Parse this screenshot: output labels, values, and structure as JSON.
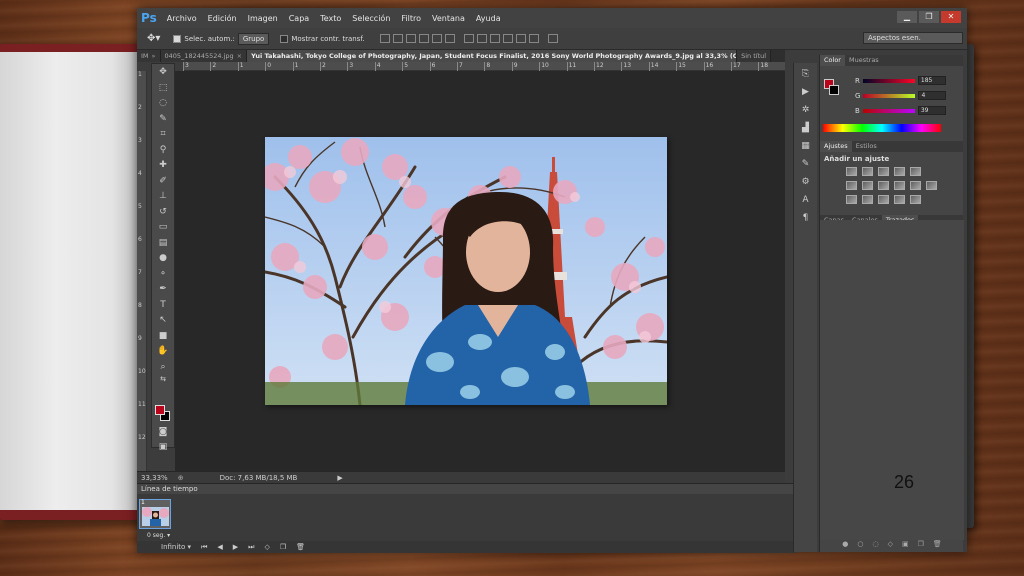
{
  "app": {
    "logo": "Ps",
    "menu": [
      "Archivo",
      "Edición",
      "Imagen",
      "Capa",
      "Texto",
      "Selección",
      "Filtro",
      "Ventana",
      "Ayuda"
    ],
    "window_buttons": [
      "▁",
      "❐",
      "✕"
    ]
  },
  "options_bar": {
    "auto_select_label": "Selec. autom.:",
    "auto_select_value": "Grupo",
    "show_transform_label": "Mostrar contr. transf.",
    "workspace": "Aspectos esen."
  },
  "tabs": [
    {
      "label": "IM",
      "active": false,
      "close": "»"
    },
    {
      "label": "0405_182445524.jpg",
      "active": false,
      "close": "×"
    },
    {
      "label": "Yui Takahashi, Tokyo College of Photography, Japan, Student Focus Finalist, 2016 Sony World Photography Awards_9.jpg al 33,3% (Capa 1, RGB/8*) *",
      "active": true,
      "close": "×"
    },
    {
      "label": "Sin títul",
      "active": false,
      "close": ""
    }
  ],
  "ruler_h": [
    "3",
    "2",
    "1",
    "0",
    "1",
    "2",
    "3",
    "4",
    "5",
    "6",
    "7",
    "8",
    "9",
    "10",
    "11",
    "12",
    "13",
    "14",
    "15",
    "16",
    "17",
    "18"
  ],
  "ruler_v": [
    "1",
    "2",
    "3",
    "4",
    "5",
    "6",
    "7",
    "8",
    "9",
    "10",
    "11",
    "12"
  ],
  "status": {
    "zoom": "33,33%",
    "doc": "Doc: 7,63 MB/18,5 MB"
  },
  "timeline": {
    "title": "Línea de tiempo",
    "frame_number": "1",
    "frame_delay": "0 seg.",
    "loop": "Infinito"
  },
  "color_panel": {
    "tabs": [
      "Color",
      "Muestras"
    ],
    "channels": [
      {
        "name": "R",
        "value": "185"
      },
      {
        "name": "G",
        "value": "4"
      },
      {
        "name": "B",
        "value": "39"
      }
    ],
    "foreground": "#b9041b",
    "background": "#000000"
  },
  "adjust_panel": {
    "tabs": [
      "Ajustes",
      "Estilos"
    ],
    "heading": "Añadir un ajuste"
  },
  "layers_panel": {
    "tabs": [
      "Capas",
      "Canales",
      "Trazados"
    ]
  },
  "slide_number": "26"
}
